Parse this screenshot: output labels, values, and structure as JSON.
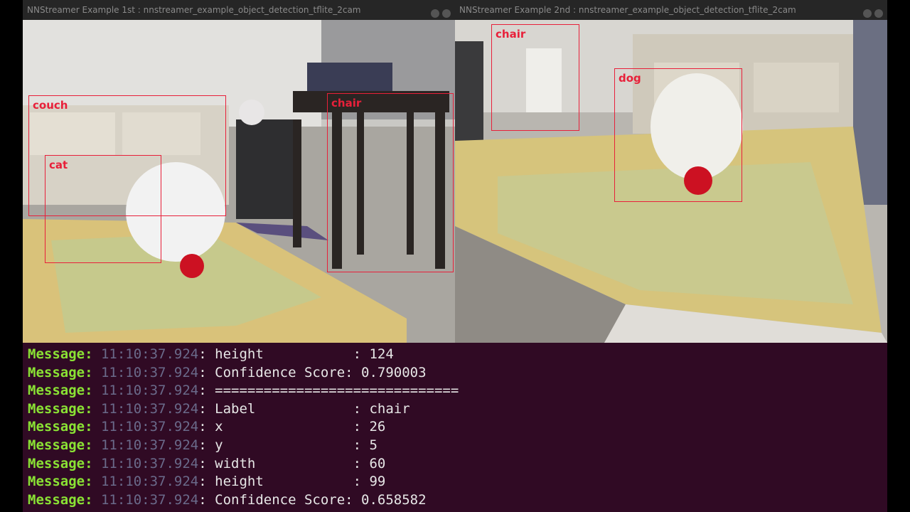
{
  "windows": [
    {
      "title": "NNStreamer Example 1st : nnstreamer_example_object_detection_tflite_2cam",
      "detections": [
        {
          "label": "couch"
        },
        {
          "label": "cat"
        },
        {
          "label": "chair"
        }
      ]
    },
    {
      "title": "NNStreamer Example 2nd : nnstreamer_example_object_detection_tflite_2cam",
      "detections": [
        {
          "label": "chair"
        },
        {
          "label": "dog"
        }
      ]
    }
  ],
  "terminal": {
    "colors": {
      "background": "#300a24",
      "level": "#8ae234",
      "timestamp": "#6a6a8a",
      "text": "#e6e6e6"
    },
    "lines": [
      {
        "level": "Message:",
        "time": "11:10:37.924",
        "text": "height           : 124"
      },
      {
        "level": "Message:",
        "time": "11:10:37.924",
        "text": "Confidence Score: 0.790003"
      },
      {
        "level": "Message:",
        "time": "11:10:37.924",
        "text": "=============================="
      },
      {
        "level": "Message:",
        "time": "11:10:37.924",
        "text": "Label            : chair"
      },
      {
        "level": "Message:",
        "time": "11:10:37.924",
        "text": "x                : 26"
      },
      {
        "level": "Message:",
        "time": "11:10:37.924",
        "text": "y                : 5"
      },
      {
        "level": "Message:",
        "time": "11:10:37.924",
        "text": "width            : 60"
      },
      {
        "level": "Message:",
        "time": "11:10:37.924",
        "text": "height           : 99"
      },
      {
        "level": "Message:",
        "time": "11:10:37.924",
        "text": "Confidence Score: 0.658582"
      }
    ]
  }
}
